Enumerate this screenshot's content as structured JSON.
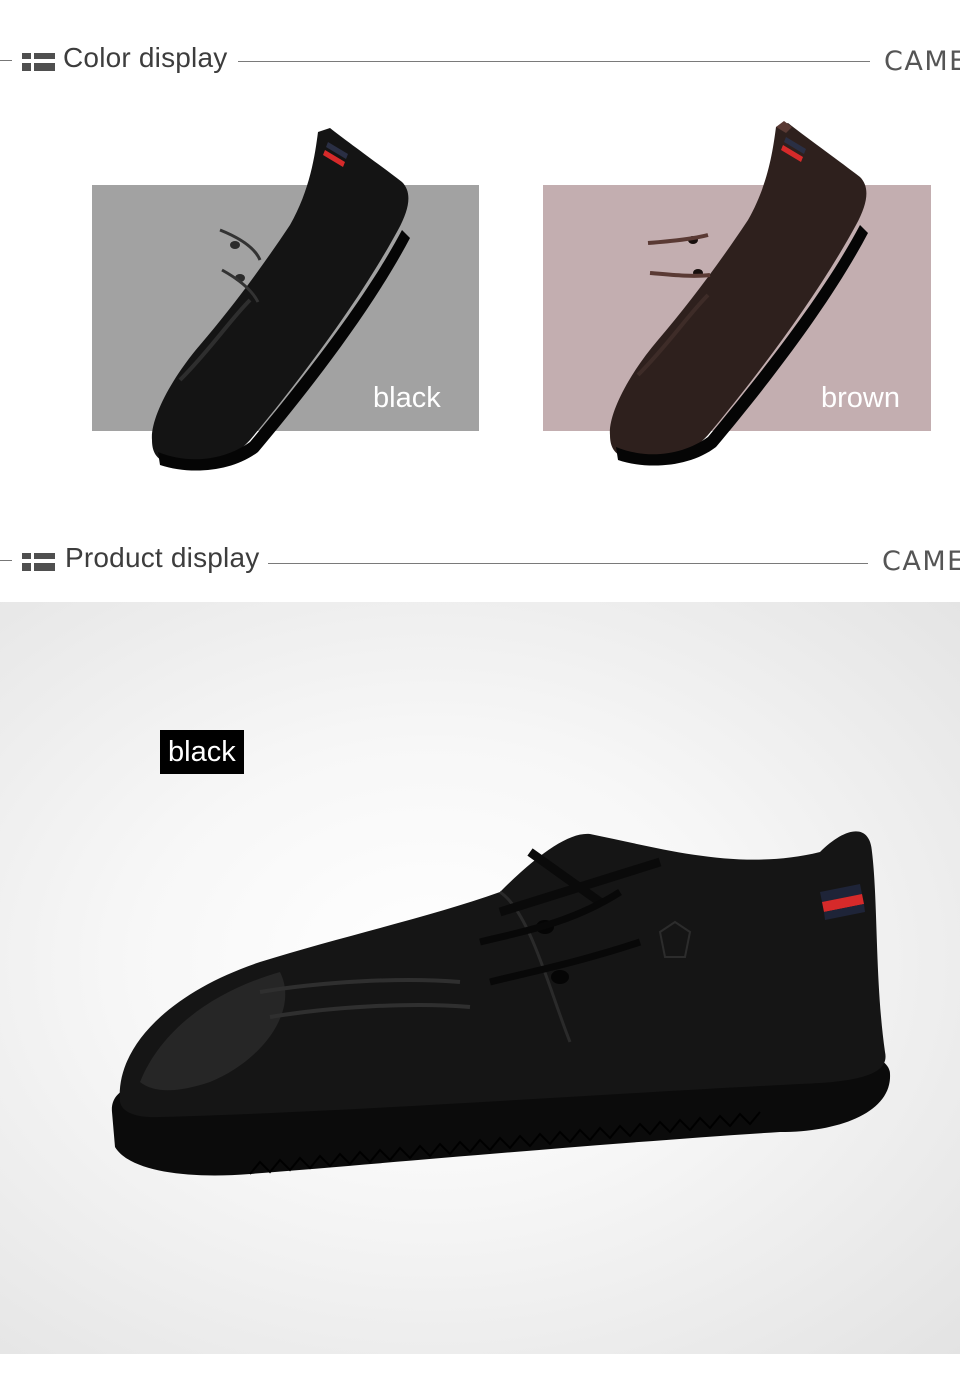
{
  "color_section": {
    "title": "Color display",
    "brand": "CAME",
    "swatches": [
      {
        "label": "black",
        "bg": "#a2a2a2",
        "shoe_color": "#151515"
      },
      {
        "label": "brown",
        "bg": "#c3aeb0",
        "shoe_color": "#2e201d"
      }
    ]
  },
  "product_section": {
    "title": "Product display",
    "brand": "CAME",
    "tag": "black"
  },
  "colors": {
    "header_text": "#3d3d3d",
    "divider": "#7a7a7a",
    "accent_stripe": "#d62a2a"
  },
  "icons": [
    "list-icon",
    "list-icon"
  ]
}
